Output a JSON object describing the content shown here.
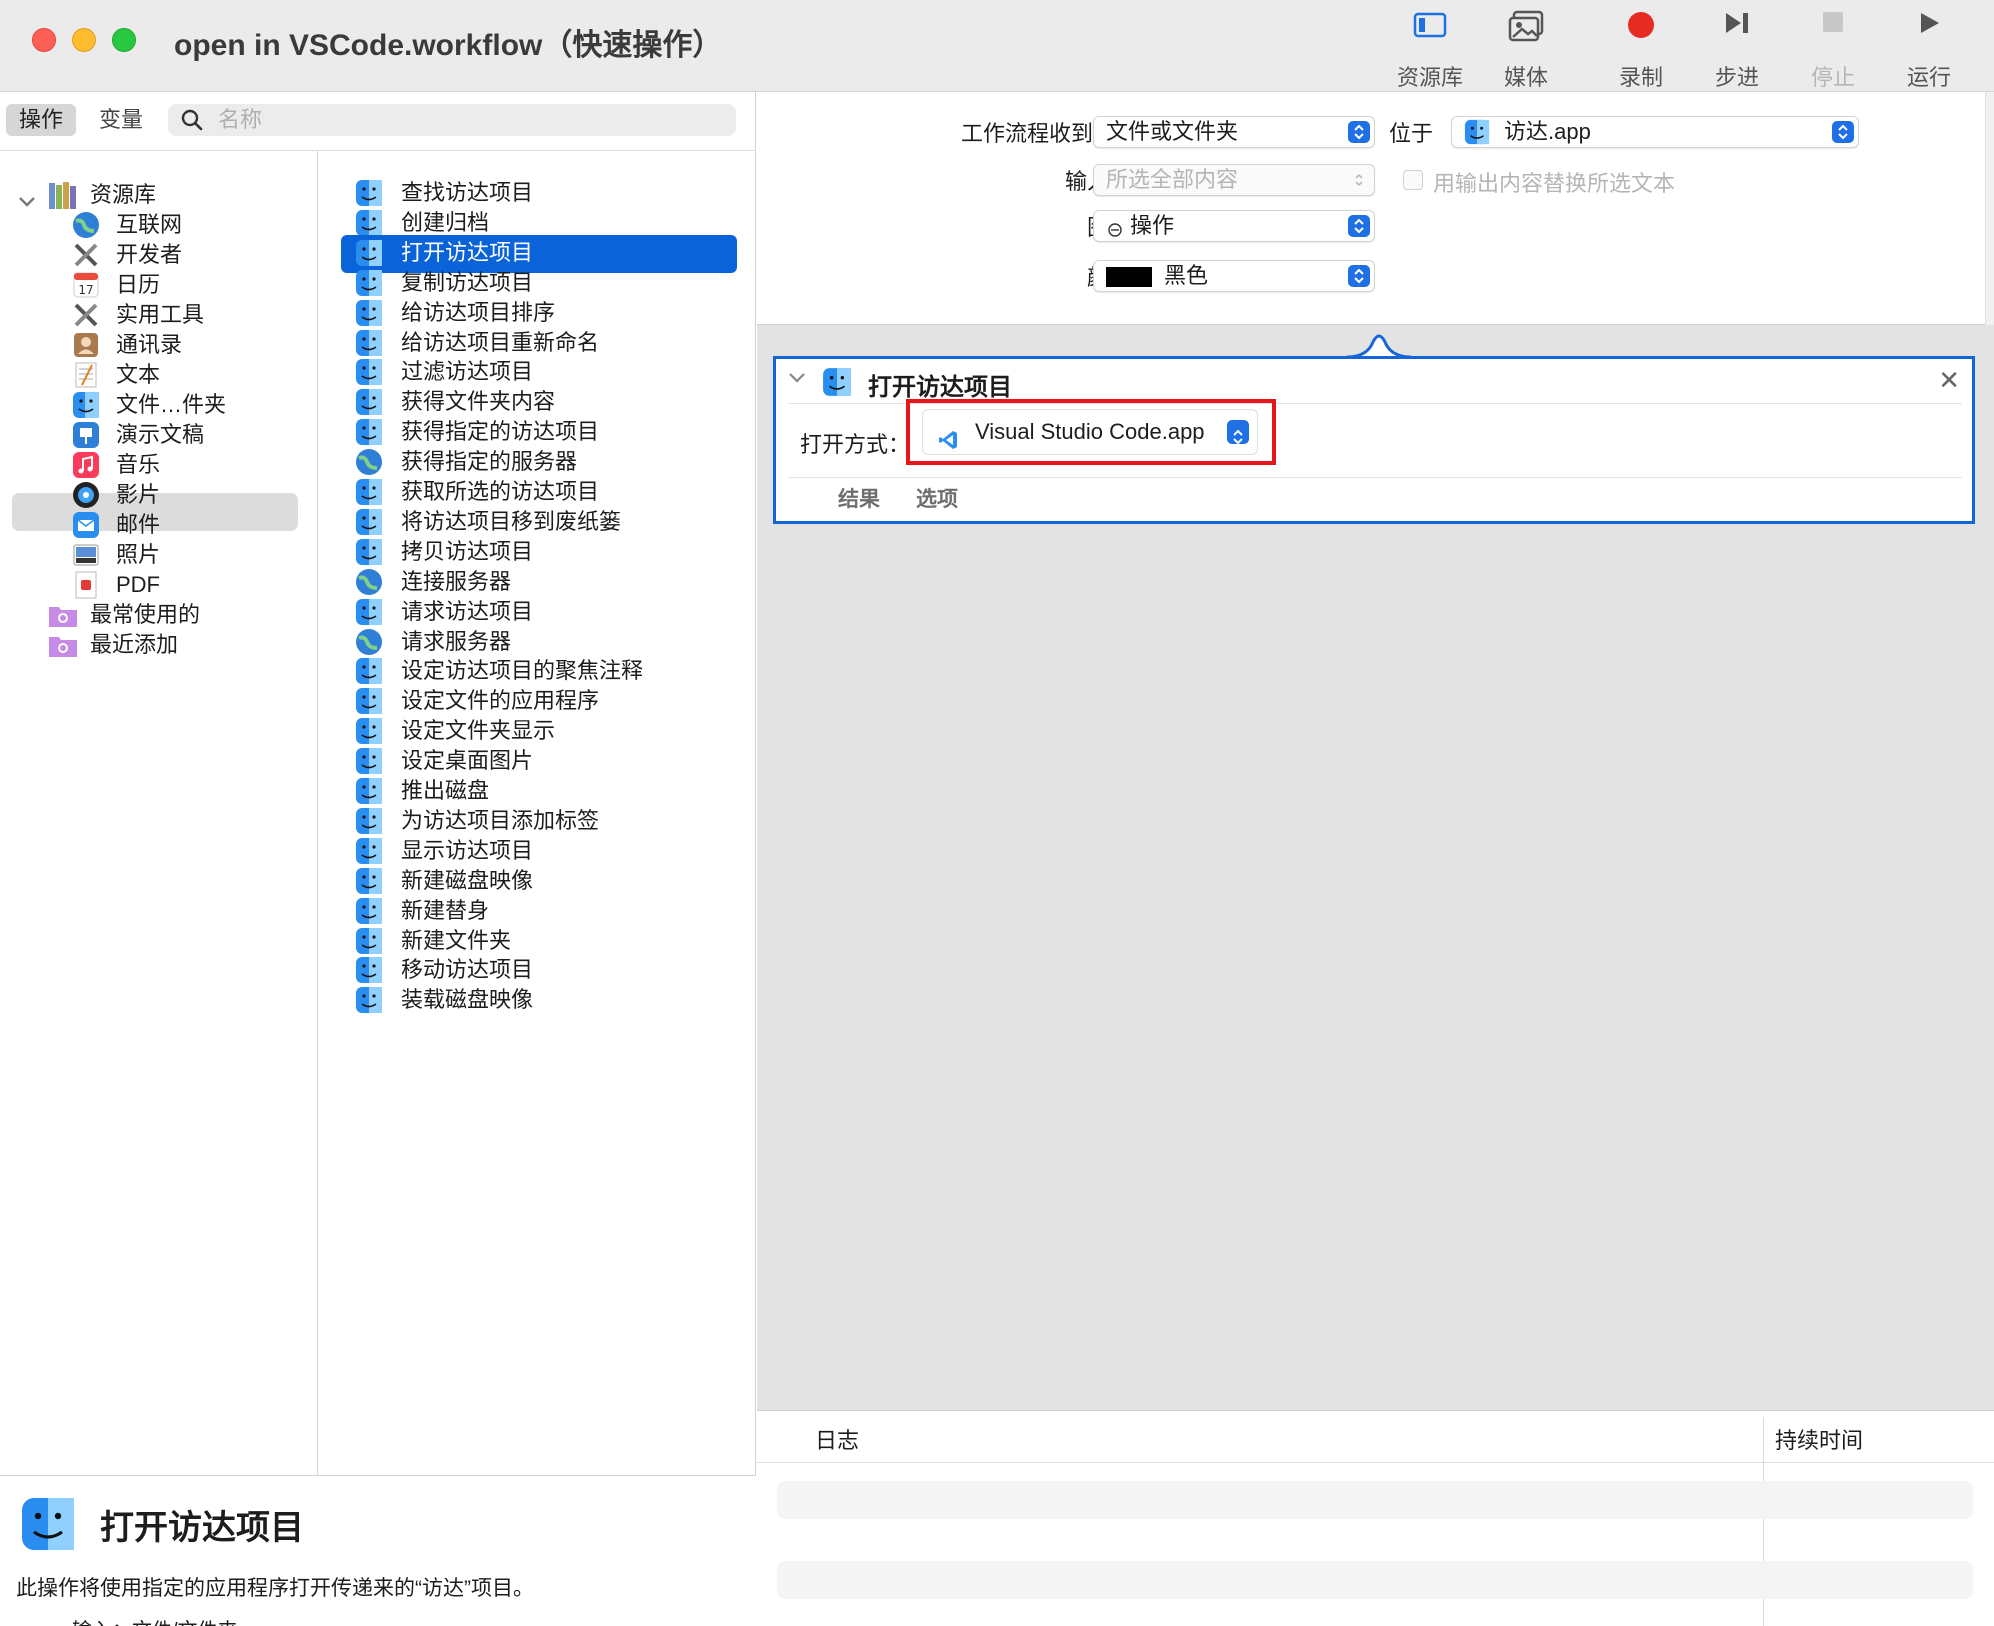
{
  "window": {
    "title": "open in VSCode.workflow（快速操作）"
  },
  "toolbar": {
    "items": [
      {
        "label": "资源库",
        "icon": "library-icon",
        "enabled": true
      },
      {
        "label": "媒体",
        "icon": "media-icon",
        "enabled": true
      },
      {
        "label": "录制",
        "icon": "record-icon",
        "enabled": true
      },
      {
        "label": "步进",
        "icon": "step-icon",
        "enabled": true
      },
      {
        "label": "停止",
        "icon": "stop-icon",
        "enabled": false
      },
      {
        "label": "运行",
        "icon": "run-icon",
        "enabled": true
      }
    ]
  },
  "sidebar": {
    "tabs": [
      "操作",
      "变量"
    ],
    "search": {
      "placeholder": "名称",
      "value": ""
    },
    "library": {
      "root": "资源库",
      "items": [
        {
          "label": "互联网",
          "icon": "globe-icon"
        },
        {
          "label": "开发者",
          "icon": "tools-icon"
        },
        {
          "label": "日历",
          "icon": "calendar-icon"
        },
        {
          "label": "实用工具",
          "icon": "utilities-icon"
        },
        {
          "label": "通讯录",
          "icon": "contacts-icon"
        },
        {
          "label": "文本",
          "icon": "text-icon"
        },
        {
          "label": "文件…件夹",
          "icon": "finder-icon",
          "selected": true
        },
        {
          "label": "演示文稿",
          "icon": "keynote-icon"
        },
        {
          "label": "音乐",
          "icon": "music-icon"
        },
        {
          "label": "影片",
          "icon": "movies-icon"
        },
        {
          "label": "邮件",
          "icon": "mail-icon"
        },
        {
          "label": "照片",
          "icon": "photos-icon"
        },
        {
          "label": "PDF",
          "icon": "pdf-icon"
        }
      ],
      "smart_groups": [
        {
          "label": "最常使用的",
          "icon": "smart-folder-icon"
        },
        {
          "label": "最近添加",
          "icon": "smart-folder-icon"
        }
      ]
    },
    "actions": [
      {
        "label": "查找访达项目",
        "icon": "finder-icon"
      },
      {
        "label": "创建归档",
        "icon": "finder-icon"
      },
      {
        "label": "打开访达项目",
        "icon": "finder-icon",
        "selected": true
      },
      {
        "label": "复制访达项目",
        "icon": "finder-icon"
      },
      {
        "label": "给访达项目排序",
        "icon": "finder-icon"
      },
      {
        "label": "给访达项目重新命名",
        "icon": "finder-icon"
      },
      {
        "label": "过滤访达项目",
        "icon": "finder-icon"
      },
      {
        "label": "获得文件夹内容",
        "icon": "finder-icon"
      },
      {
        "label": "获得指定的访达项目",
        "icon": "finder-icon"
      },
      {
        "label": "获得指定的服务器",
        "icon": "globe-icon"
      },
      {
        "label": "获取所选的访达项目",
        "icon": "finder-icon"
      },
      {
        "label": "将访达项目移到废纸篓",
        "icon": "finder-icon"
      },
      {
        "label": "拷贝访达项目",
        "icon": "finder-icon"
      },
      {
        "label": "连接服务器",
        "icon": "globe-icon"
      },
      {
        "label": "请求访达项目",
        "icon": "finder-icon"
      },
      {
        "label": "请求服务器",
        "icon": "globe-icon"
      },
      {
        "label": "设定访达项目的聚焦注释",
        "icon": "finder-icon"
      },
      {
        "label": "设定文件的应用程序",
        "icon": "finder-icon"
      },
      {
        "label": "设定文件夹显示",
        "icon": "finder-icon"
      },
      {
        "label": "设定桌面图片",
        "icon": "finder-icon"
      },
      {
        "label": "推出磁盘",
        "icon": "finder-icon"
      },
      {
        "label": "为访达项目添加标签",
        "icon": "finder-icon"
      },
      {
        "label": "显示访达项目",
        "icon": "finder-icon"
      },
      {
        "label": "新建磁盘映像",
        "icon": "finder-icon"
      },
      {
        "label": "新建替身",
        "icon": "finder-icon"
      },
      {
        "label": "新建文件夹",
        "icon": "finder-icon"
      },
      {
        "label": "移动访达项目",
        "icon": "finder-icon"
      },
      {
        "label": "装载磁盘映像",
        "icon": "finder-icon"
      }
    ]
  },
  "description": {
    "title": "打开访达项目",
    "text": "此操作将使用指定的应用程序打开传递来的“访达”项目。",
    "input_line": "输入：文件/文件夹"
  },
  "workflow_settings": {
    "receives_label": "工作流程收到当前",
    "receives_value": "文件或文件夹",
    "in_label": "位于",
    "in_value": "访达.app",
    "input_is_label": "输入为",
    "input_is_value": "所选全部内容",
    "replace_label": "用输出内容替换所选文本",
    "image_label": "图像",
    "image_value": "操作",
    "color_label": "颜色",
    "color_value": "黑色",
    "color_swatch": "#000000"
  },
  "action_card": {
    "title": "打开访达项目",
    "open_with_label": "打开方式：",
    "open_with_value": "Visual Studio Code.app",
    "tabs": [
      "结果",
      "选项"
    ],
    "highlight_color": "#e8141b",
    "border_color": "#1565d8"
  },
  "log": {
    "col_log": "日志",
    "col_duration": "持续时间"
  },
  "colors": {
    "accent": "#0a63d8",
    "record": "#e62b22"
  }
}
